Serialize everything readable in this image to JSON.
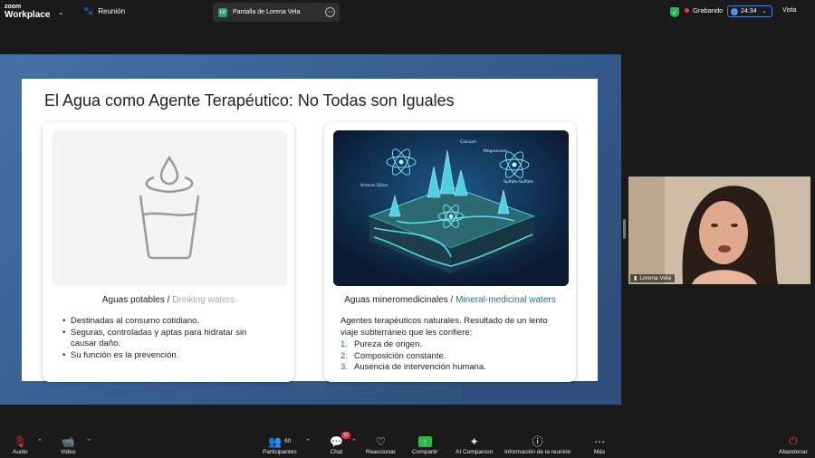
{
  "topbar": {
    "logo_line1": "zoom",
    "logo_line2": "Workplace",
    "meeting_label": "Reunión",
    "tab_badge": "LV",
    "tab_label": "Pantalla de Lorena Vela",
    "recording_label": "Grabando",
    "timer": "24:34",
    "view_label": "Vista"
  },
  "slide": {
    "title": "El Agua como Agente Terapéutico: No Todas son Iguales",
    "card1": {
      "heading_es": "Aguas potables",
      "separator": " / ",
      "heading_en": "Drinking waters",
      "bullets": [
        "Destinadas al consumo cotidiano.",
        "Seguras, controladas y aptas para hidratar sin causar daño.",
        "Su función es la prevención."
      ]
    },
    "card2": {
      "heading_es": "Aguas mineromedicinales",
      "separator": " / ",
      "heading_en": "Mineral-medicinal waters",
      "intro": "Agentes terapéuticos naturales. Resultado de un lento viaje subterráneo que les confiere:",
      "items": [
        {
          "num": "1.",
          "text": "Pureza de origen."
        },
        {
          "num": "2.",
          "text": "Composición constante."
        },
        {
          "num": "3.",
          "text": "Ausencia de intervención humana."
        }
      ],
      "image_labels": [
        "Calcium",
        "Magnesium",
        "Sulfate",
        "Sulfate",
        "Arsenic Silica"
      ]
    }
  },
  "participant": {
    "name": "Lorena Vela"
  },
  "toolbar": {
    "audio": "Audio",
    "video": "Video",
    "participants": "Participantes",
    "participants_count": "60",
    "chat": "Chat",
    "chat_badge": "11",
    "react": "Reaccionar",
    "share": "Compartir",
    "ai": "AI Companion",
    "info": "Información de la reunión",
    "more": "Más",
    "leave": "Abandonar"
  },
  "colors": {
    "accent_green": "#2fb64e",
    "recording_red": "#e63b3b",
    "timer_blue": "#4a8ff2",
    "slide_background": "#4770a6"
  }
}
